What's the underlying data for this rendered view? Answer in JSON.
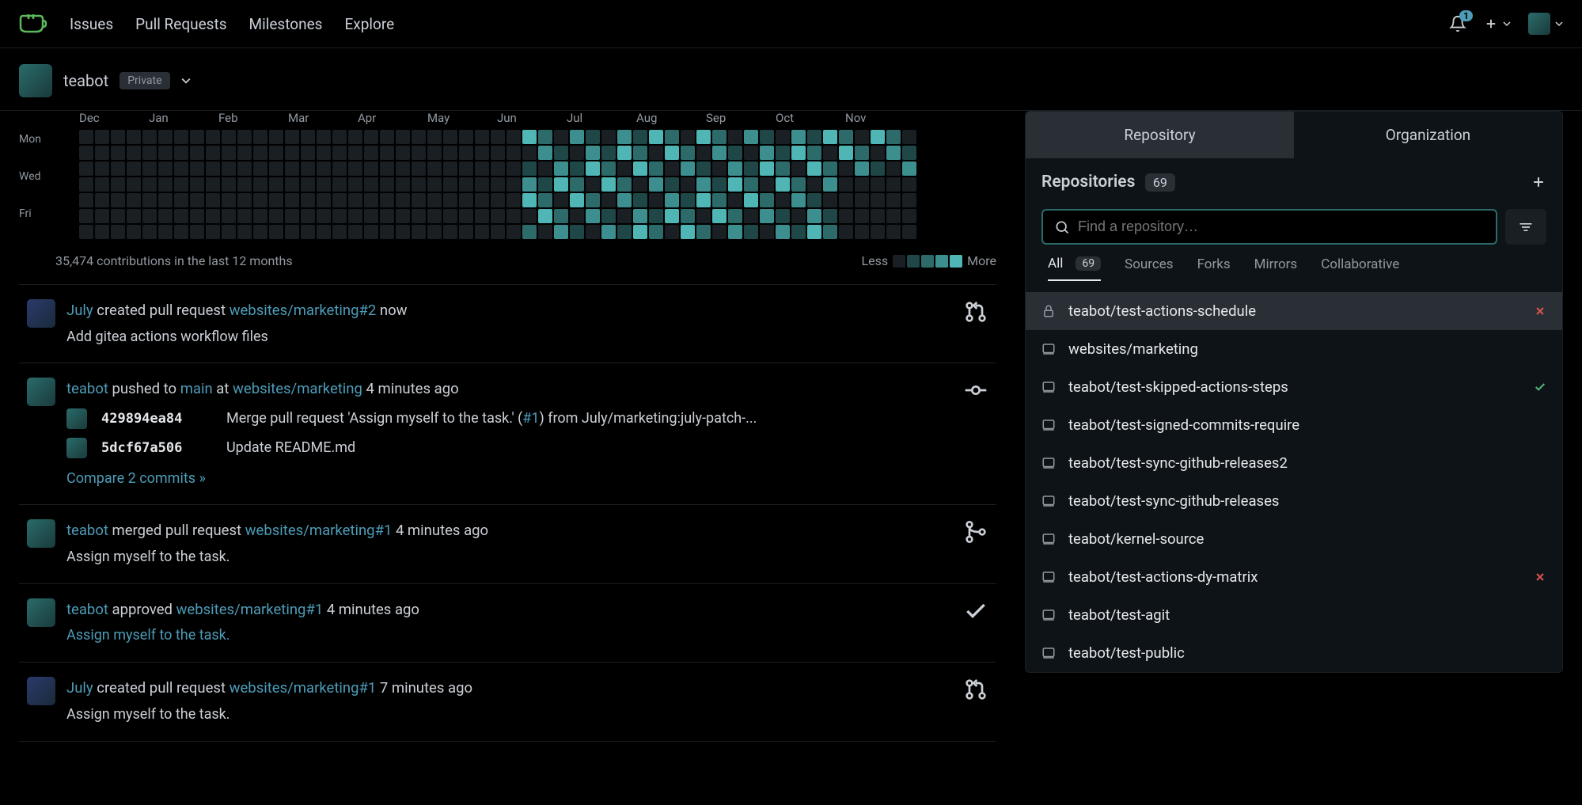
{
  "nav": {
    "items": [
      "Issues",
      "Pull Requests",
      "Milestones",
      "Explore"
    ],
    "notification_count": "1"
  },
  "profile": {
    "name": "teabot",
    "visibility": "Private"
  },
  "heatmap": {
    "months": [
      "Dec",
      "Jan",
      "Feb",
      "Mar",
      "Apr",
      "May",
      "Jun",
      "Jul",
      "Aug",
      "Sep",
      "Oct",
      "Nov"
    ],
    "days": [
      "Mon",
      "Wed",
      "Fri"
    ],
    "summary": "35,474 contributions in the last 12 months",
    "legend_less": "Less",
    "legend_more": "More"
  },
  "feed": [
    {
      "type": "pr_open",
      "actor": "July",
      "avatar": "user2",
      "verb": "created pull request",
      "target": "websites/marketing#2",
      "time": "now",
      "subtitle": "Add gitea actions workflow files"
    },
    {
      "type": "push",
      "actor": "teabot",
      "avatar": "user1",
      "verb_pre": "pushed to",
      "branch": "main",
      "at": "at",
      "repo": "websites/marketing",
      "time": "4 minutes ago",
      "commits": [
        {
          "hash": "429894ea84",
          "msg_pre": "Merge pull request 'Assign myself to the task.' (",
          "link": "#1",
          "msg_post": ") from July/marketing:july-patch-..."
        },
        {
          "hash": "5dcf67a506",
          "msg": "Update README.md",
          "avatar": "user2"
        }
      ],
      "compare": "Compare 2 commits »"
    },
    {
      "type": "pr_merge",
      "actor": "teabot",
      "avatar": "user1",
      "verb": "merged pull request",
      "target": "websites/marketing#1",
      "time": "4 minutes ago",
      "subtitle": "Assign myself to the task."
    },
    {
      "type": "approve",
      "actor": "teabot",
      "avatar": "user1",
      "verb": "approved",
      "target": "websites/marketing#1",
      "time": "4 minutes ago",
      "subtitle_link": "Assign myself to the task."
    },
    {
      "type": "pr_open",
      "actor": "July",
      "avatar": "user2",
      "verb": "created pull request",
      "target": "websites/marketing#1",
      "time": "7 minutes ago",
      "subtitle": "Assign myself to the task."
    }
  ],
  "sidebar": {
    "tabs": [
      "Repository",
      "Organization"
    ],
    "active_tab": 0,
    "title": "Repositories",
    "count": "69",
    "search_placeholder": "Find a repository…",
    "filters": [
      {
        "label": "All",
        "count": "69"
      },
      {
        "label": "Sources"
      },
      {
        "label": "Forks"
      },
      {
        "label": "Mirrors"
      },
      {
        "label": "Collaborative"
      }
    ],
    "repos": [
      {
        "name": "teabot/test-actions-schedule",
        "icon": "lock",
        "status": "fail",
        "hover": true
      },
      {
        "name": "websites/marketing",
        "icon": "repo"
      },
      {
        "name": "teabot/test-skipped-actions-steps",
        "icon": "repo",
        "status": "ok"
      },
      {
        "name": "teabot/test-signed-commits-require",
        "icon": "repo"
      },
      {
        "name": "teabot/test-sync-github-releases2",
        "icon": "repo"
      },
      {
        "name": "teabot/test-sync-github-releases",
        "icon": "repo"
      },
      {
        "name": "teabot/kernel-source",
        "icon": "repo"
      },
      {
        "name": "teabot/test-actions-dy-matrix",
        "icon": "repo",
        "status": "fail"
      },
      {
        "name": "teabot/test-agit",
        "icon": "repo"
      },
      {
        "name": "teabot/test-public",
        "icon": "repo"
      }
    ]
  }
}
